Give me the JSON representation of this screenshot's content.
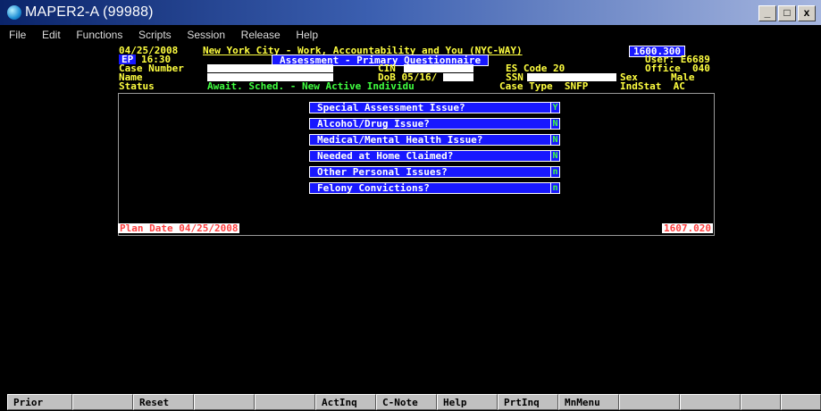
{
  "window": {
    "title": "MAPER2-A (99988)",
    "buttons": {
      "minimize": "_",
      "maximize": "□",
      "close": "x"
    }
  },
  "menu": [
    "File",
    "Edit",
    "Functions",
    "Scripts",
    "Session",
    "Release",
    "Help"
  ],
  "header": {
    "date": "04/25/2008",
    "system_title": "New York City - Work, Accountability and You (NYC-WAY)",
    "screen_code": "1600.300",
    "ep_label": "EP",
    "time": "16:30",
    "screen_name": "Assessment - Primary Questionnaire",
    "user": "User: E6689",
    "case_number_label": "Case Number",
    "cin_label": "CIN",
    "es_code": "ES Code 20",
    "office": "Office  040",
    "name_label": "Name",
    "dob": "DoB 05/16/",
    "ssn_label": "SSN",
    "sex_label": "Sex",
    "sex_value": "Male",
    "status_label": "Status",
    "status_value": "Await. Sched. - New Active Individu",
    "case_type": "Case Type  SNFP",
    "indstat": "IndStat  AC"
  },
  "questions": [
    {
      "label": "Special Assessment Issue?",
      "answer": "Y"
    },
    {
      "label": "Alcohol/Drug Issue?",
      "answer": "N"
    },
    {
      "label": "Medical/Mental Health Issue?",
      "answer": "N"
    },
    {
      "label": "Needed at Home Claimed?",
      "answer": "N"
    },
    {
      "label": "Other Personal Issues?",
      "answer": "n"
    },
    {
      "label": "Felony Convictions?",
      "answer": "n"
    }
  ],
  "plan_date": "Plan Date 04/25/2008",
  "panel_code": "1607.020",
  "function_keys": [
    "Prior",
    "",
    "Reset",
    "",
    "",
    "ActInq",
    "C-Note",
    "Help",
    "PrtInq",
    "MnMenu",
    "",
    "",
    "",
    ""
  ],
  "colors": {
    "terminal_bg": "#000000",
    "field_blue": "#1818ff",
    "text_yellow": "#ffff40",
    "text_green": "#40ff40",
    "text_red": "#ff4040"
  }
}
